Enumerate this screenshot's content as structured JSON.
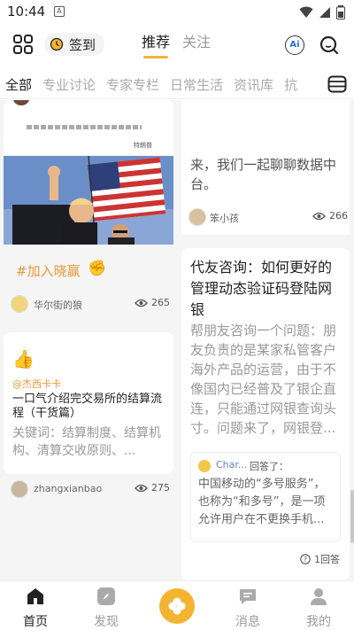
{
  "status": {
    "time": "10:44",
    "notif_glyph": "A"
  },
  "header": {
    "checkin_label": "签到",
    "tabs": [
      {
        "label": "推荐",
        "active": true
      },
      {
        "label": "关注",
        "active": false
      }
    ],
    "ai_label": "Ai"
  },
  "categories": [
    {
      "label": "全部",
      "active": true
    },
    {
      "label": "专业讨论",
      "active": false
    },
    {
      "label": "专家专栏",
      "active": false
    },
    {
      "label": "日常生活",
      "active": false
    },
    {
      "label": "资讯库",
      "active": false
    },
    {
      "label": "抗",
      "active": false
    }
  ],
  "feed": {
    "left": {
      "photo_caption": "特朗普",
      "post1": {
        "hashtag": "#加入晓赢",
        "author": "华尔街的狼",
        "views": "265"
      },
      "post2": {
        "mention": "@杰西卡卡",
        "title": "一口气介绍完交易所的结算流程（干货篇）",
        "desc": "关键词：结算制度、结算机构、清算交收原则、...",
        "author": "zhangxianbao",
        "views": "275"
      }
    },
    "right": {
      "post0": {
        "text": "来，我们一起聊聊数据中台。",
        "author": "笨小孩",
        "views": "266"
      },
      "post1": {
        "title": "代友咨询：如何更好的管理动态验证码登陆网银",
        "desc": "帮朋友咨询一个问题：朋友负责的是某家私管客户海外产品的运营，由于不像国内已经普及了银企直连，只能通过网银查询头寸。问题来了，网银登...",
        "reply_name": "Char...",
        "reply_label": "回答了：",
        "reply_text": "中国移动的“多号服务”，也称为“和多号”，是一项允许用户在不更换手机...",
        "answers": "1回答"
      }
    }
  },
  "bottomnav": [
    {
      "label": "首页",
      "active": true
    },
    {
      "label": "发现",
      "active": false
    },
    {
      "label": "消息",
      "active": false
    },
    {
      "label": "我的",
      "active": false
    }
  ],
  "colors": {
    "accent": "#f3b531",
    "hashtag": "#e39a3a",
    "link": "#6b84b8"
  }
}
